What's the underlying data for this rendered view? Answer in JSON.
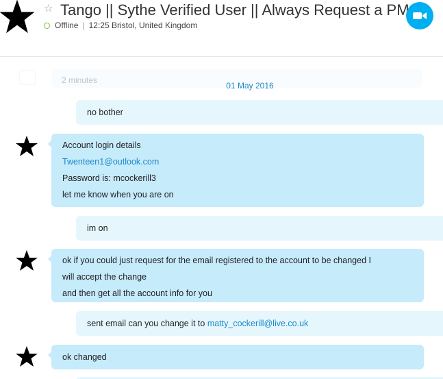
{
  "header": {
    "title": "Tango || Sythe Verified User || Always Request a PM",
    "status": "Offline",
    "time_location": "12:25 Bristol, United Kingdom",
    "accent_color": "#00aff0",
    "presence_color": "#7dc242"
  },
  "faded": {
    "text": "2 minutes"
  },
  "conversation": {
    "date": "01 May 2016",
    "messages": [
      {
        "from": "me",
        "lines": [
          "no bother"
        ]
      },
      {
        "from": "contact",
        "lines": [
          "Account login details",
          "Twenteen1@outlook.com",
          "Password is: mcockerill3",
          "let me know when you are on"
        ]
      },
      {
        "from": "me",
        "lines": [
          "im on"
        ]
      },
      {
        "from": "contact",
        "lines": [
          "ok if you could just request for the email registered to the account to be changed I",
          "will accept the change",
          "and then get all the account info for you"
        ]
      },
      {
        "from": "me",
        "text": "sent email can you change it to",
        "link": "matty_cockerill@live.co.uk"
      },
      {
        "from": "contact",
        "lines": [
          "ok changed"
        ]
      }
    ]
  },
  "icons": {
    "favorite": "star-outline-icon",
    "presence": "presence-ring-icon",
    "video": "video-camera-icon",
    "avatar": "star-avatar-icon"
  }
}
